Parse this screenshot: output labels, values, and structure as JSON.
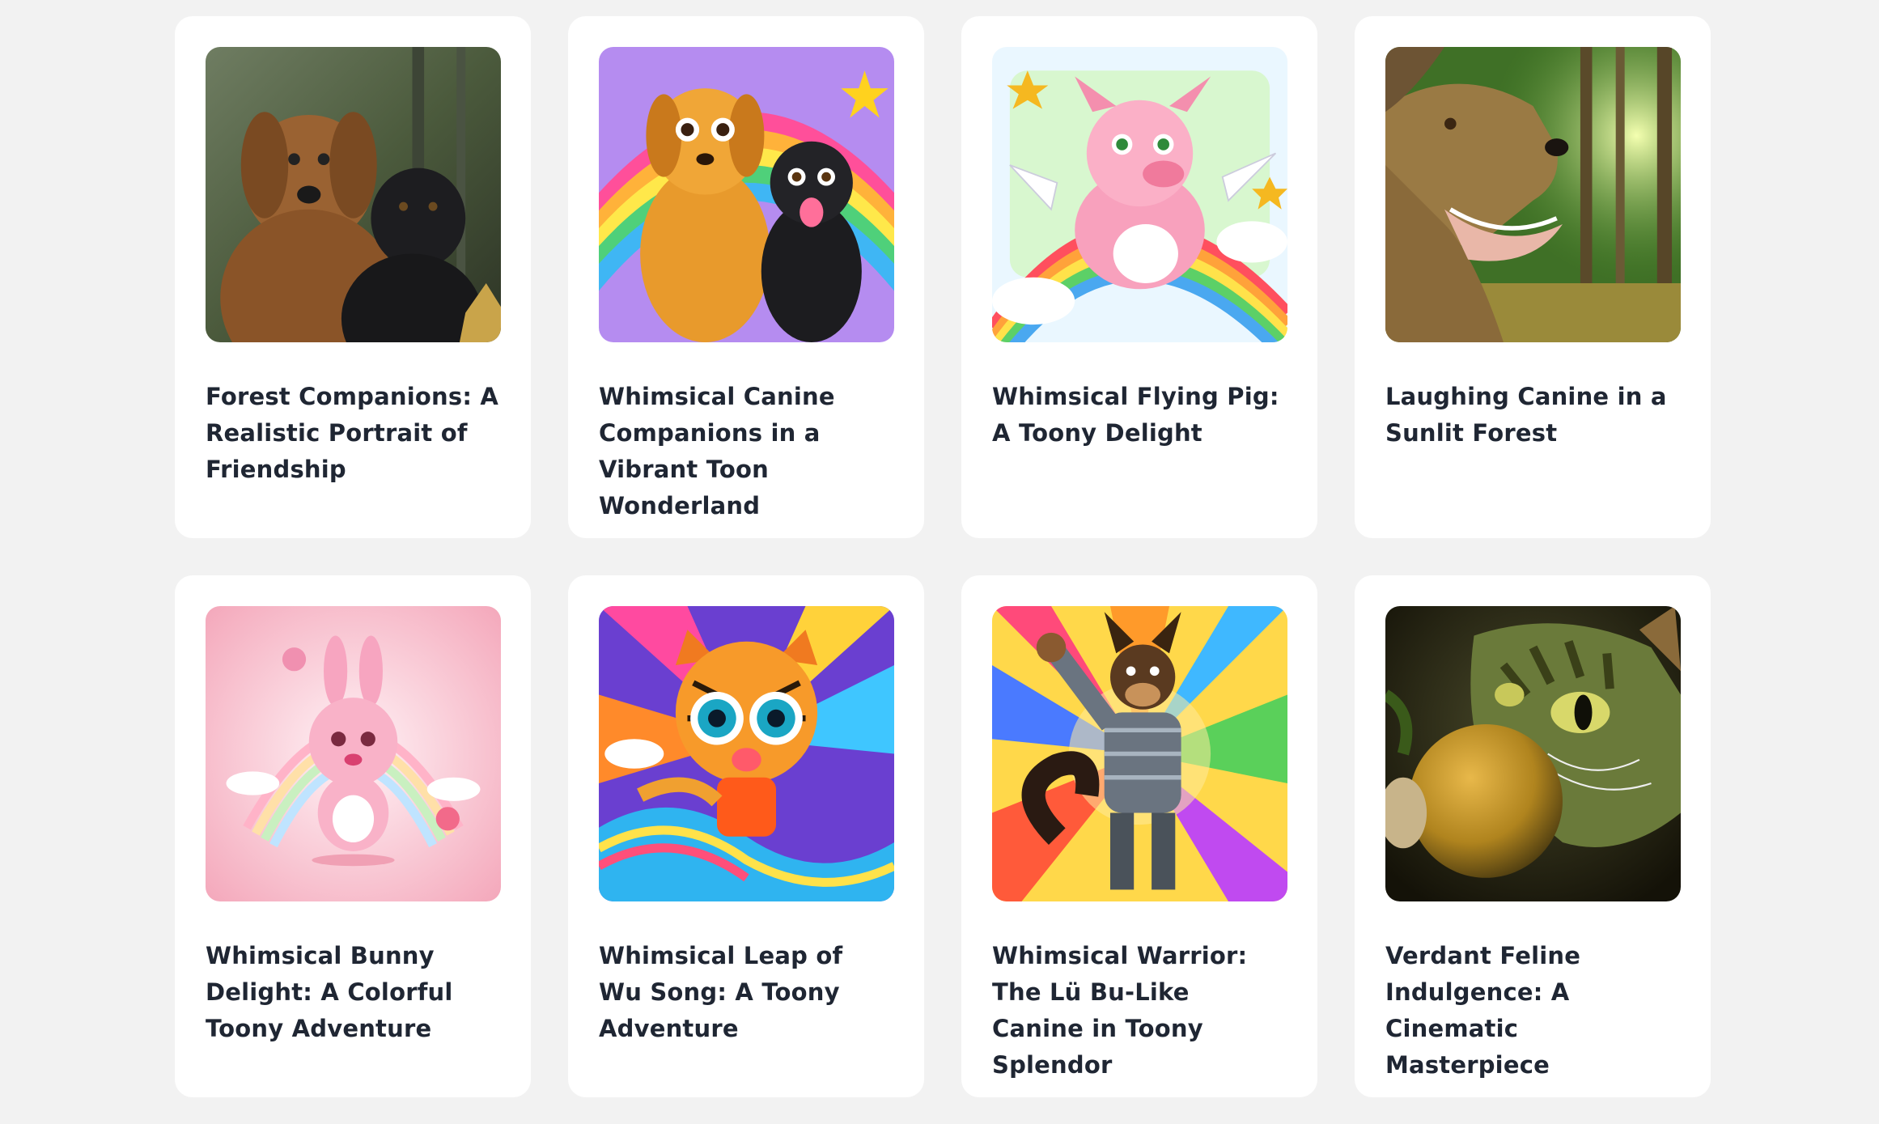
{
  "gallery": {
    "cards": [
      {
        "title": "Forest Companions: A Realistic Portrait of Friendship",
        "image": "two-dogs-forest-realistic"
      },
      {
        "title": "Whimsical Canine Companions in a Vibrant Toon Wonderland",
        "image": "two-cartoon-dogs-rainbow"
      },
      {
        "title": "Whimsical Flying Pig: A Toony Delight",
        "image": "cartoon-flying-pig-rainbow"
      },
      {
        "title": "Laughing Canine in a Sunlit Forest",
        "image": "laughing-dog-sunlit-forest"
      },
      {
        "title": "Whimsical Bunny Delight: A Colorful Toony Adventure",
        "image": "cartoon-pink-bunny"
      },
      {
        "title": "Whimsical Leap of Wu Song: A Toony Adventure",
        "image": "cartoon-tiger-cub-rainbow"
      },
      {
        "title": "Whimsical Warrior: The Lü Bu-Like Canine in Toony Splendor",
        "image": "armored-warrior-dog"
      },
      {
        "title": "Verdant Feline Indulgence: A Cinematic Masterpiece",
        "image": "green-cat-eating-fruit"
      }
    ]
  }
}
